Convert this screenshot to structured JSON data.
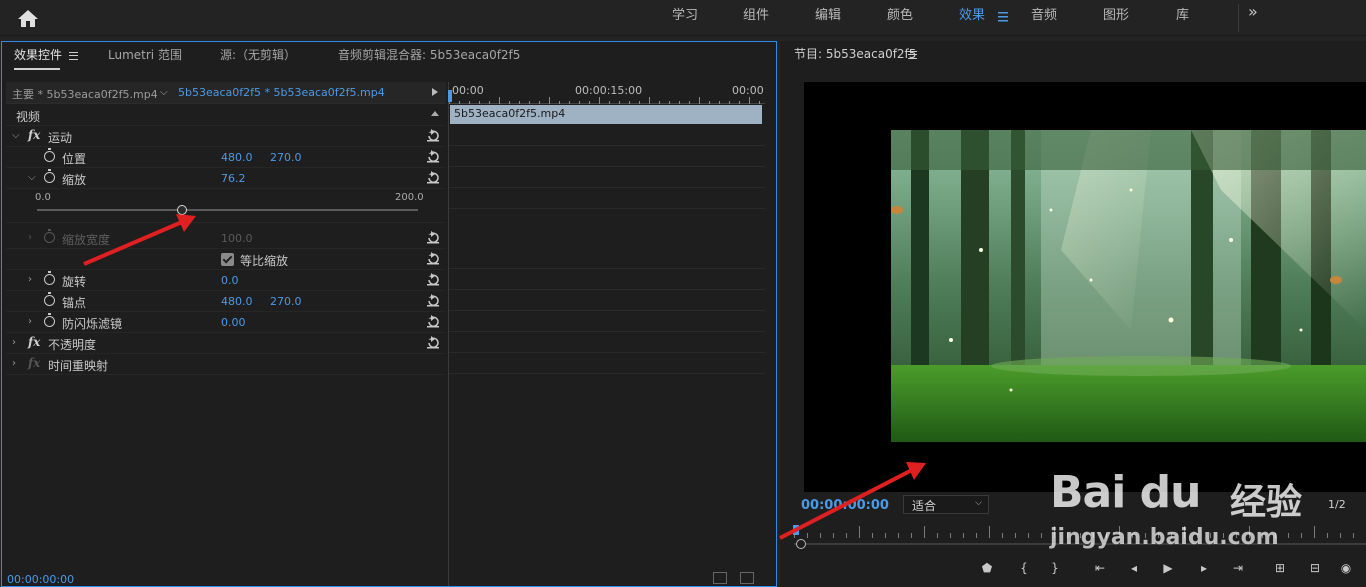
{
  "workspaces": [
    {
      "label": "学习",
      "active": false
    },
    {
      "label": "组件",
      "active": false
    },
    {
      "label": "编辑",
      "active": false
    },
    {
      "label": "颜色",
      "active": false
    },
    {
      "label": "效果",
      "active": true
    },
    {
      "label": "音频",
      "active": false
    },
    {
      "label": "图形",
      "active": false
    },
    {
      "label": "库",
      "active": false
    }
  ],
  "workspace_overflow": "»",
  "left_tabs": [
    "效果控件",
    "Lumetri 范围",
    "源:（无剪辑）",
    "音频剪辑混合器: 5b53eaca0f2f5"
  ],
  "clip_selector": {
    "master": "主要 * 5b53eaca0f2f5.mp4",
    "sequence": "5b53eaca0f2f5 * 5b53eaca0f2f5.mp4"
  },
  "properties": {
    "video_header": "视频",
    "motion": "运动",
    "position": {
      "label": "位置",
      "x": "480.0",
      "y": "270.0"
    },
    "scale": {
      "label": "缩放",
      "value": "76.2"
    },
    "scale_slider": {
      "min": "0.0",
      "max": "200.0",
      "value": 76.2,
      "range_max": 200
    },
    "scale_width": {
      "label": "缩放宽度",
      "value": "100.0"
    },
    "uniform_scale": {
      "label": "等比缩放",
      "checked": true
    },
    "rotation": {
      "label": "旋转",
      "value": "0.0"
    },
    "anchor": {
      "label": "锚点",
      "x": "480.0",
      "y": "270.0"
    },
    "antiflicker": {
      "label": "防闪烁滤镜",
      "value": "0.00"
    },
    "opacity": "不透明度",
    "time_remap": "时间重映射"
  },
  "timeline": {
    "t_start": "00:00",
    "t_mid": "00:00:15:00",
    "t_end": "00:00",
    "clip_name": "5b53eaca0f2f5.mp4"
  },
  "left_timecode": "00:00:00:00",
  "program": {
    "title": "节目: 5b53eaca0f2f5",
    "timecode": "00:00:00:00",
    "fit_label": "适合",
    "fraction": "1/2"
  },
  "controls": [
    "marker-icon",
    "mark-in-icon",
    "mark-out-icon",
    "go-to-in-icon",
    "step-back-icon",
    "play-icon",
    "step-forward-icon",
    "go-to-out-icon",
    "insert-icon",
    "overwrite-icon",
    "export-frame-icon"
  ],
  "watermark": {
    "brand": "Bai du",
    "cn": "经验",
    "url": "jingyan.baidu.com"
  },
  "colors": {
    "accent": "#4a9ae8",
    "arrow": "#e02020",
    "panel_border": "#2d8ceb"
  }
}
